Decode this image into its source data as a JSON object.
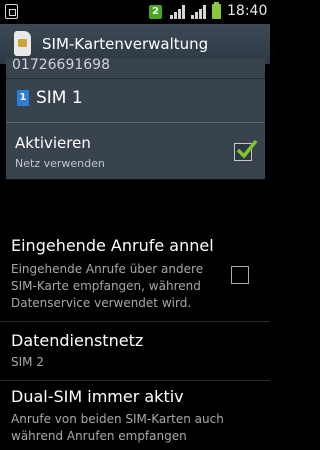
{
  "status_bar": {
    "sim_badge": "2",
    "time": "18:40",
    "battery_color": "#8bc63e",
    "icons": [
      "sd-card-icon",
      "signal-sim1-icon",
      "signal-sim2-icon",
      "battery-icon"
    ]
  },
  "action_bar": {
    "title": "SIM-Kartenverwaltung",
    "icon": "sim-card-icon"
  },
  "card": {
    "phone_number": "01726691698",
    "sim_badge": "1",
    "sim_name": "SIM 1",
    "activate_title": "Aktivieren",
    "activate_sub": "Netz verwenden",
    "activate_checked": true
  },
  "settings": [
    {
      "title": "Eingehende Anrufe annel",
      "summary_lines": [
        "Eingehende Anrufe über andere",
        "SIM-Karte empfangen, während",
        "Datenservice verwendet wird."
      ],
      "checked": false
    },
    {
      "title": "Datendienstnetz",
      "summary_lines": [
        "SIM 2"
      ]
    },
    {
      "title": "Dual-SIM immer aktiv",
      "summary_lines": [
        "Anrufe von beiden SIM-Karten auch",
        "während Anrufen empfangen"
      ]
    }
  ],
  "colors": {
    "accent_check": "#7fc62e",
    "sim1_badge": "#2a7fd6",
    "sim2_badge": "#48a81c",
    "action_bar": "#34404b"
  }
}
